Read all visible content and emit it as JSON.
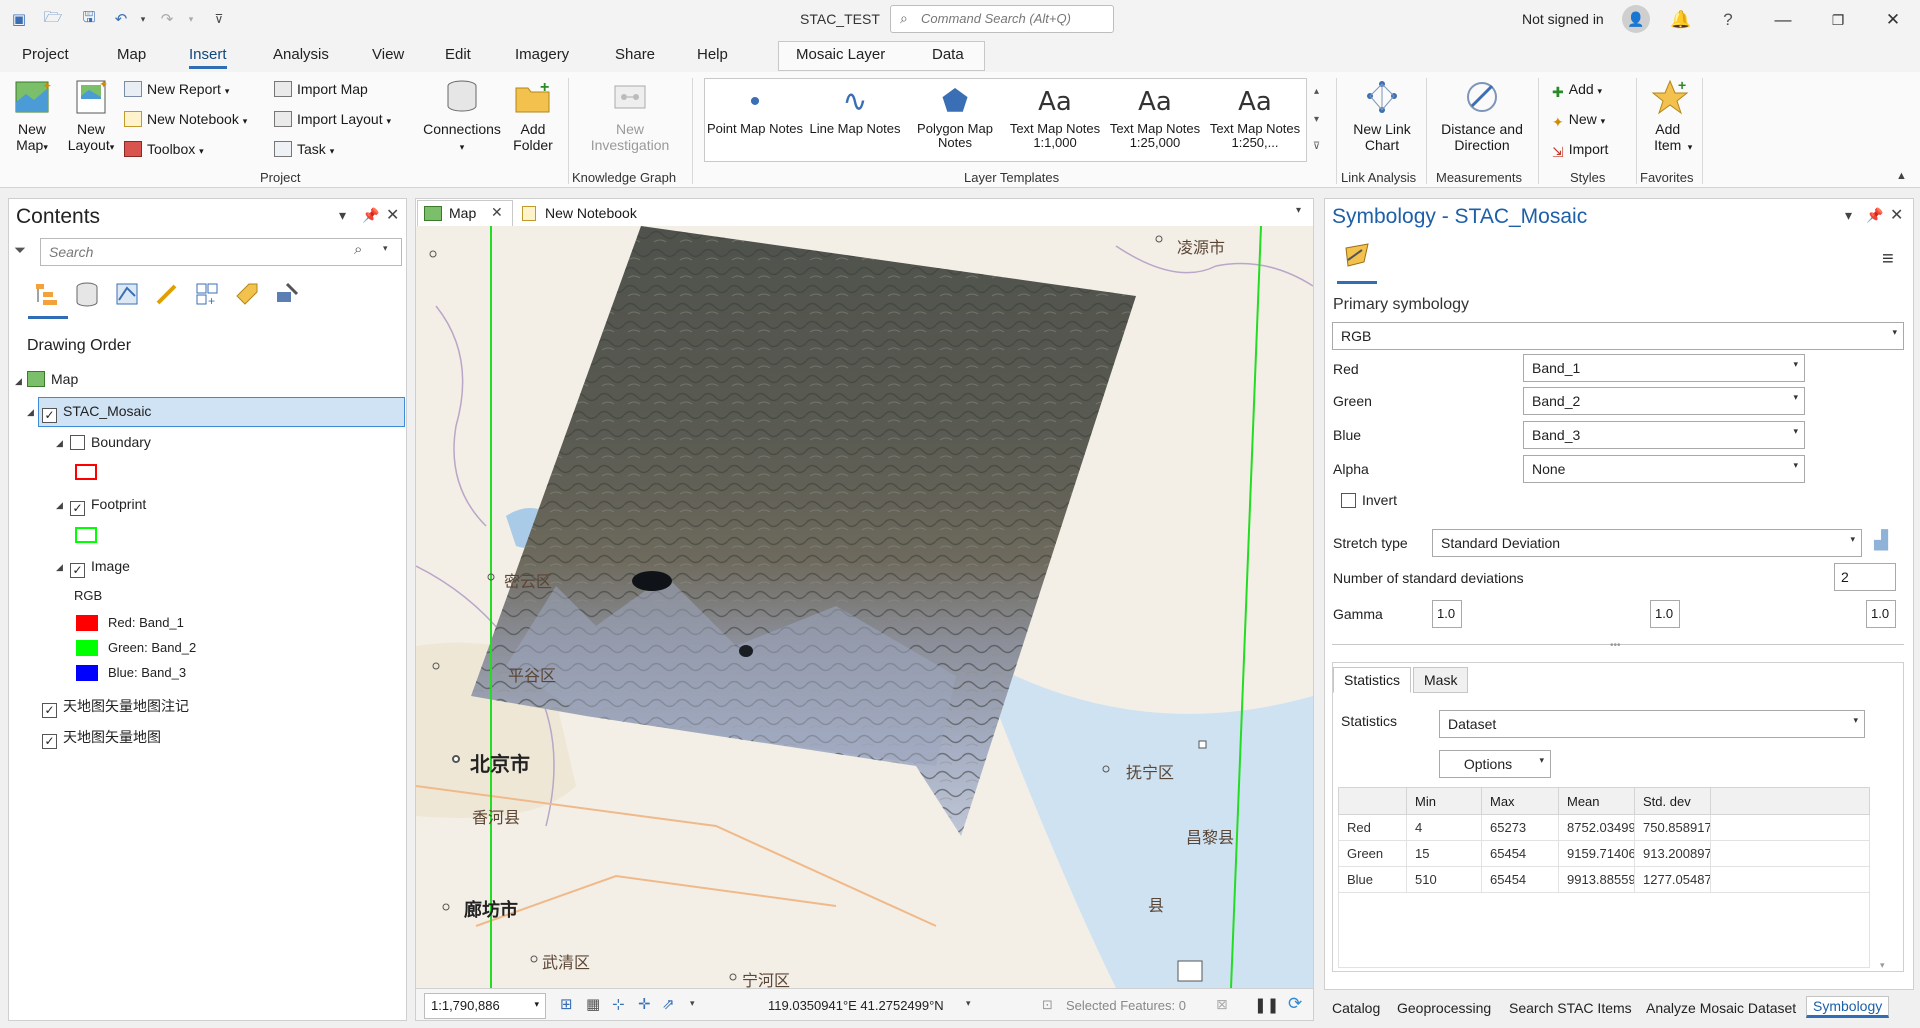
{
  "app": {
    "title": "STAC_TEST",
    "command_search_placeholder": "Command Search (Alt+Q)",
    "sign_in": "Not signed in"
  },
  "menu": {
    "tabs": [
      "Project",
      "Map",
      "Insert",
      "Analysis",
      "View",
      "Edit",
      "Imagery",
      "Share",
      "Help"
    ],
    "active": "Insert",
    "context_tabs": [
      "Mosaic Layer",
      "Data"
    ]
  },
  "ribbon": {
    "new_map": "New Map",
    "new_layout": "New Layout",
    "new_report": "New Report",
    "new_notebook": "New Notebook",
    "toolbox": "Toolbox",
    "import_map": "Import Map",
    "import_layout": "Import Layout",
    "task": "Task",
    "connections": "Connections",
    "add_folder": "Add Folder",
    "project_group": "Project",
    "new_investigation": "New Investigation",
    "knowledge_graph_group": "Knowledge Graph",
    "templates": [
      {
        "label": "Point Map Notes",
        "icon": "point-icon"
      },
      {
        "label": "Line Map Notes",
        "icon": "line-icon"
      },
      {
        "label": "Polygon Map Notes",
        "icon": "polygon-icon"
      },
      {
        "label": "Text Map Notes 1:1,000",
        "icon": "text-icon"
      },
      {
        "label": "Text Map Notes 1:25,000",
        "icon": "text-icon"
      },
      {
        "label": "Text Map Notes 1:250,...",
        "icon": "text-icon"
      }
    ],
    "layer_templates_group": "Layer Templates",
    "new_link_chart": "New Link Chart",
    "link_analysis_group": "Link Analysis",
    "distance_direction": "Distance and Direction",
    "measurements_group": "Measurements",
    "styles_add": "Add",
    "styles_new": "New",
    "styles_import": "Import",
    "styles_group": "Styles",
    "add_item": "Add Item",
    "favorites_group": "Favorites"
  },
  "contents": {
    "title": "Contents",
    "search_placeholder": "Search",
    "drawing_order": "Drawing Order",
    "map": "Map",
    "stac_mosaic": "STAC_Mosaic",
    "boundary": "Boundary",
    "footprint": "Footprint",
    "image": "Image",
    "rgb": "RGB",
    "red": "Red:  Band_1",
    "green": "Green: Band_2",
    "blue": "Blue:  Band_3",
    "layer1": "天地图矢量地图注记",
    "layer2": "天地图矢量地图",
    "colors": {
      "red": "#ff0000",
      "green": "#00ff00",
      "blue": "#0000ff",
      "boundary": "#ff0000",
      "footprint": "#00ff00"
    }
  },
  "map": {
    "tabs": [
      "Map",
      "New Notebook"
    ],
    "places": [
      "凌源市",
      "密云区",
      "平谷区",
      "北京市",
      "香河县",
      "抚宁区",
      "昌黎县",
      "廊坊市",
      "武清区",
      "宁河区",
      "县"
    ],
    "scale": "1:1,790,886",
    "coords": "119.0350941°E 41.2752499°N",
    "selected_features": "Selected Features: 0"
  },
  "symbology": {
    "title": "Symbology - STAC_Mosaic",
    "primary": "Primary symbology",
    "renderer": "RGB",
    "red_label": "Red",
    "red_value": "Band_1",
    "green_label": "Green",
    "green_value": "Band_2",
    "blue_label": "Blue",
    "blue_value": "Band_3",
    "alpha_label": "Alpha",
    "alpha_value": "None",
    "invert": "Invert",
    "stretch_label": "Stretch type",
    "stretch_value": "Standard Deviation",
    "nstd_label": "Number of standard deviations",
    "nstd_value": "2",
    "gamma_label": "Gamma",
    "gamma": [
      "1.0",
      "1.0",
      "1.0"
    ],
    "tabs": [
      "Statistics",
      "Mask"
    ],
    "statistics_label": "Statistics",
    "statistics_value": "Dataset",
    "options": "Options",
    "table": {
      "headers": [
        "",
        "Min",
        "Max",
        "Mean",
        "Std. dev"
      ],
      "rows": [
        [
          "Red",
          "4",
          "65273",
          "8752.03499",
          "750.858917"
        ],
        [
          "Green",
          "15",
          "65454",
          "9159.71406",
          "913.200897"
        ],
        [
          "Blue",
          "510",
          "65454",
          "9913.88559",
          "1277.05487"
        ]
      ]
    }
  },
  "bottom_tabs": [
    "Catalog",
    "Geoprocessing",
    "Search STAC Items",
    "Analyze Mosaic Dataset",
    "Symbology"
  ]
}
